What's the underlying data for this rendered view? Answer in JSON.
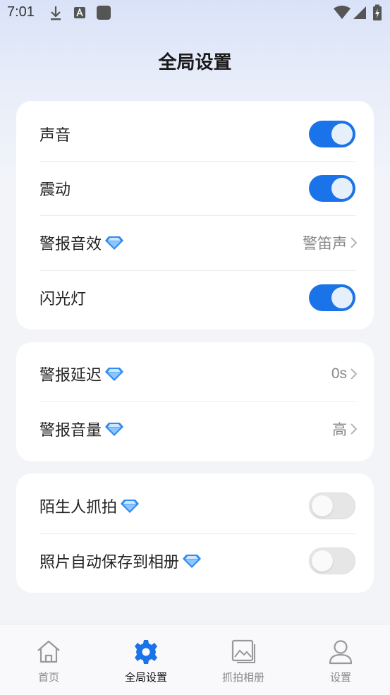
{
  "status_bar": {
    "time": "7:01"
  },
  "page": {
    "title": "全局设置"
  },
  "colors": {
    "accent": "#1a73e8",
    "gem": "#2f8cf0"
  },
  "group1": [
    {
      "label": "声音",
      "type": "toggle",
      "on": true
    },
    {
      "label": "震动",
      "type": "toggle",
      "on": true
    },
    {
      "label": "警报音效",
      "type": "select",
      "value": "警笛声",
      "premium": true
    },
    {
      "label": "闪光灯",
      "type": "toggle",
      "on": true
    }
  ],
  "group2": [
    {
      "label": "警报延迟",
      "type": "select",
      "value": "0s",
      "premium": true
    },
    {
      "label": "警报音量",
      "type": "select",
      "value": "高",
      "premium": true
    }
  ],
  "group3": [
    {
      "label": "陌生人抓拍",
      "type": "toggle",
      "on": false,
      "premium": true
    },
    {
      "label": "照片自动保存到相册",
      "type": "toggle",
      "on": false,
      "premium": true
    }
  ],
  "tabbar": {
    "items": [
      {
        "label": "首页",
        "icon": "home-icon",
        "active": false
      },
      {
        "label": "全局设置",
        "icon": "gear-icon",
        "active": true
      },
      {
        "label": "抓拍相册",
        "icon": "gallery-icon",
        "active": false
      },
      {
        "label": "设置",
        "icon": "user-icon",
        "active": false
      }
    ]
  }
}
